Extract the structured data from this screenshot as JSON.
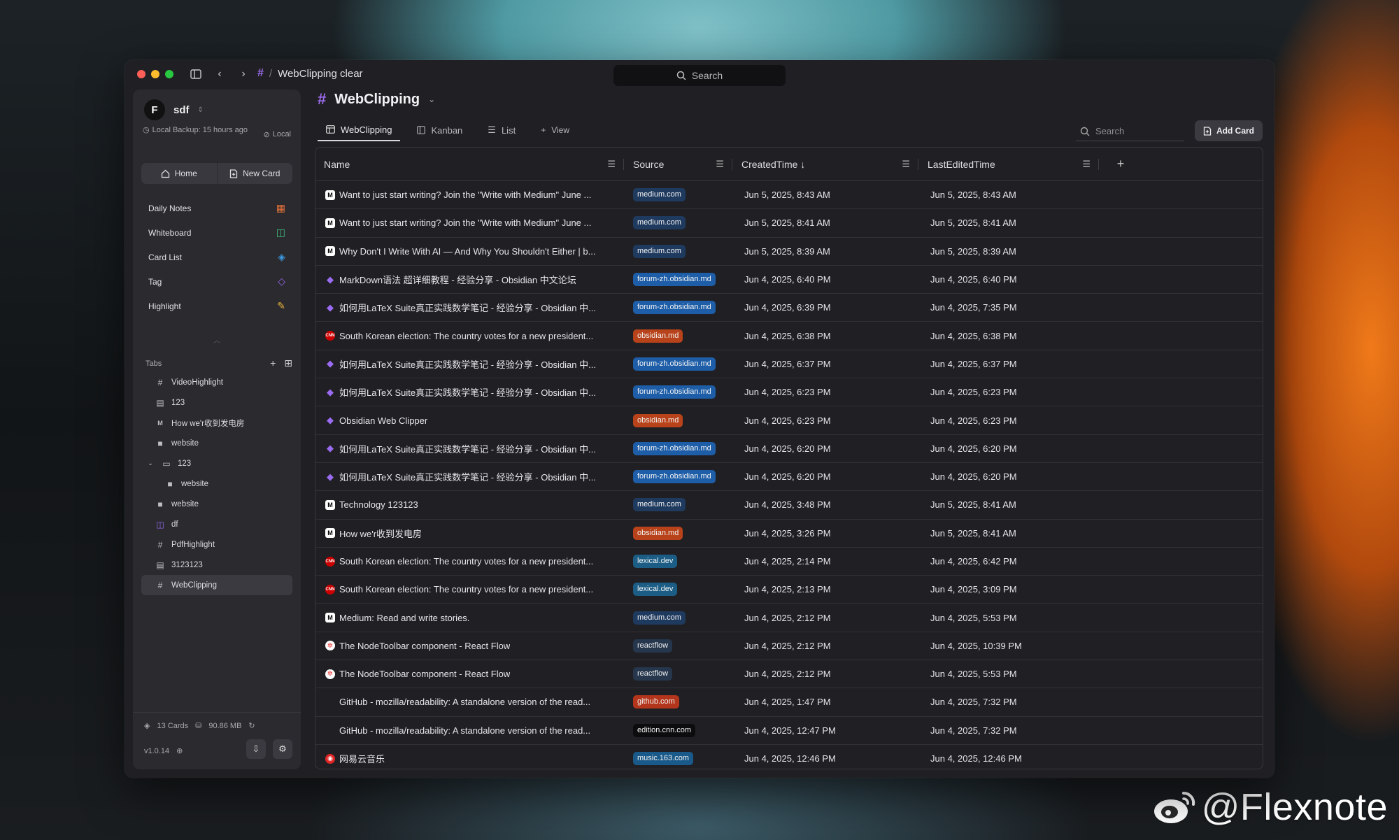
{
  "titlebar": {
    "breadcrumb_hash": "#",
    "breadcrumb_sep": "/",
    "breadcrumb_title": "WebClipping clear",
    "search_label": "Search"
  },
  "sidebar": {
    "workspace_name": "sdf",
    "backup_text": "Local Backup: 15 hours ago",
    "local_label": "Local",
    "home_label": "Home",
    "new_card_label": "New Card",
    "menu": [
      {
        "label": "Daily Notes",
        "icon": "calendar-icon",
        "color": "#e0703a"
      },
      {
        "label": "Whiteboard",
        "icon": "map-icon",
        "color": "#3fbf7f"
      },
      {
        "label": "Card List",
        "icon": "layers-icon",
        "color": "#3b9ae0"
      },
      {
        "label": "Tag",
        "icon": "tag-icon",
        "color": "#9b6cf3"
      },
      {
        "label": "Highlight",
        "icon": "highlighter-icon",
        "color": "#e8b33a"
      }
    ],
    "tabs_label": "Tabs",
    "tabs": [
      {
        "label": "VideoHighlight",
        "icon": "hash-icon"
      },
      {
        "label": "123",
        "icon": "document-icon"
      },
      {
        "label": "How we'r收到发电房",
        "icon": "medium-icon"
      },
      {
        "label": "website",
        "icon": "square-icon"
      },
      {
        "label": "123",
        "icon": "folder-icon"
      },
      {
        "label": "website",
        "icon": "square-icon"
      },
      {
        "label": "website",
        "icon": "square-icon"
      },
      {
        "label": "df",
        "icon": "map-icon"
      },
      {
        "label": "PdfHighlight",
        "icon": "hash-icon"
      },
      {
        "label": "3123123",
        "icon": "document-icon"
      },
      {
        "label": "WebClipping",
        "icon": "hash-icon"
      }
    ],
    "cards_count": "13 Cards",
    "storage": "90.86 MB",
    "version": "v1.0.14"
  },
  "main": {
    "title": "WebClipping",
    "views": [
      {
        "label": "WebClipping",
        "icon": "table-icon"
      },
      {
        "label": "Kanban",
        "icon": "kanban-icon"
      },
      {
        "label": "List",
        "icon": "list-icon"
      },
      {
        "label": "View",
        "icon": "plus-icon"
      }
    ],
    "search_placeholder": "Search",
    "add_card_label": "Add Card",
    "columns": [
      "Name",
      "Source",
      "CreatedTime",
      "LastEditedTime"
    ],
    "sort_arrow": "↓",
    "rows": [
      {
        "fav": "medium",
        "name": "Want to just start writing? Join the \"Write with Medium\" June ...",
        "source": "medium.com",
        "color": "#1f3a5f",
        "created": "Jun 5, 2025, 8:43 AM",
        "edited": "Jun 5, 2025, 8:43 AM"
      },
      {
        "fav": "medium",
        "name": "Want to just start writing? Join the \"Write with Medium\" June ...",
        "source": "medium.com",
        "color": "#1f3a5f",
        "created": "Jun 5, 2025, 8:41 AM",
        "edited": "Jun 5, 2025, 8:41 AM"
      },
      {
        "fav": "medium",
        "name": "Why Don't I Write With AI — And Why You Shouldn't Either | b...",
        "source": "medium.com",
        "color": "#1f3a5f",
        "created": "Jun 5, 2025, 8:39 AM",
        "edited": "Jun 5, 2025, 8:39 AM"
      },
      {
        "fav": "obsidian",
        "name": "MarkDown语法 超详细教程 - 经验分享 - Obsidian 中文论坛",
        "source": "forum-zh.obsidian.md",
        "color": "#1e5ea8",
        "created": "Jun 4, 2025, 6:40 PM",
        "edited": "Jun 4, 2025, 6:40 PM"
      },
      {
        "fav": "obsidian",
        "name": "如何用LaTeX Suite真正实践数学笔记 - 经验分享 - Obsidian 中...",
        "source": "forum-zh.obsidian.md",
        "color": "#1e5ea8",
        "created": "Jun 4, 2025, 6:39 PM",
        "edited": "Jun 4, 2025, 7:35 PM"
      },
      {
        "fav": "cnn",
        "name": "South Korean election: The country votes for a new president...",
        "source": "obsidian.md",
        "color": "#b8431a",
        "created": "Jun 4, 2025, 6:38 PM",
        "edited": "Jun 4, 2025, 6:38 PM"
      },
      {
        "fav": "obsidian",
        "name": "如何用LaTeX Suite真正实践数学笔记 - 经验分享 - Obsidian 中...",
        "source": "forum-zh.obsidian.md",
        "color": "#1e5ea8",
        "created": "Jun 4, 2025, 6:37 PM",
        "edited": "Jun 4, 2025, 6:37 PM"
      },
      {
        "fav": "obsidian",
        "name": "如何用LaTeX Suite真正实践数学笔记 - 经验分享 - Obsidian 中...",
        "source": "forum-zh.obsidian.md",
        "color": "#1e5ea8",
        "created": "Jun 4, 2025, 6:23 PM",
        "edited": "Jun 4, 2025, 6:23 PM"
      },
      {
        "fav": "obsidian",
        "name": "Obsidian Web Clipper",
        "source": "obsidian.md",
        "color": "#b8431a",
        "created": "Jun 4, 2025, 6:23 PM",
        "edited": "Jun 4, 2025, 6:23 PM"
      },
      {
        "fav": "obsidian",
        "name": "如何用LaTeX Suite真正实践数学笔记 - 经验分享 - Obsidian 中...",
        "source": "forum-zh.obsidian.md",
        "color": "#1e5ea8",
        "created": "Jun 4, 2025, 6:20 PM",
        "edited": "Jun 4, 2025, 6:20 PM"
      },
      {
        "fav": "obsidian",
        "name": "如何用LaTeX Suite真正实践数学笔记 - 经验分享 - Obsidian 中...",
        "source": "forum-zh.obsidian.md",
        "color": "#1e5ea8",
        "created": "Jun 4, 2025, 6:20 PM",
        "edited": "Jun 4, 2025, 6:20 PM"
      },
      {
        "fav": "medium",
        "name": "Technology 123123",
        "source": "medium.com",
        "color": "#1f3a5f",
        "created": "Jun 4, 2025, 3:48 PM",
        "edited": "Jun 5, 2025, 8:41 AM"
      },
      {
        "fav": "medium",
        "name": "How we'r收到发电房",
        "source": "obsidian.md",
        "color": "#b8431a",
        "created": "Jun 4, 2025, 3:26 PM",
        "edited": "Jun 5, 2025, 8:41 AM"
      },
      {
        "fav": "cnn",
        "name": "South Korean election: The country votes for a new president...",
        "source": "lexical.dev",
        "color": "#1c5d86",
        "created": "Jun 4, 2025, 2:14 PM",
        "edited": "Jun 4, 2025, 6:42 PM"
      },
      {
        "fav": "cnn",
        "name": "South Korean election: The country votes for a new president...",
        "source": "lexical.dev",
        "color": "#1c5d86",
        "created": "Jun 4, 2025, 2:13 PM",
        "edited": "Jun 4, 2025, 3:09 PM"
      },
      {
        "fav": "medium",
        "name": "Medium: Read and write stories.",
        "source": "medium.com",
        "color": "#1f3a5f",
        "created": "Jun 4, 2025, 2:12 PM",
        "edited": "Jun 4, 2025, 5:53 PM"
      },
      {
        "fav": "react",
        "name": "The NodeToolbar component - React Flow",
        "source": "reactflow",
        "color": "#25364d",
        "created": "Jun 4, 2025, 2:12 PM",
        "edited": "Jun 4, 2025, 10:39 PM"
      },
      {
        "fav": "react",
        "name": "The NodeToolbar component - React Flow",
        "source": "reactflow",
        "color": "#25364d",
        "created": "Jun 4, 2025, 2:12 PM",
        "edited": "Jun 4, 2025, 5:53 PM"
      },
      {
        "fav": "none",
        "name": "GitHub - mozilla/readability: A standalone version of the read...",
        "source": "github.com",
        "color": "#b3361c",
        "created": "Jun 4, 2025, 1:47 PM",
        "edited": "Jun 4, 2025, 7:32 PM"
      },
      {
        "fav": "none",
        "name": "GitHub - mozilla/readability: A standalone version of the read...",
        "source": "edition.cnn.com",
        "color": "#0c0c0e",
        "created": "Jun 4, 2025, 12:47 PM",
        "edited": "Jun 4, 2025, 7:32 PM"
      },
      {
        "fav": "netease",
        "name": "网易云音乐",
        "source": "music.163.com",
        "color": "#1a5a8a",
        "created": "Jun 4, 2025, 12:46 PM",
        "edited": "Jun 4, 2025, 12:46 PM"
      }
    ]
  },
  "watermark": "@Flexnote"
}
